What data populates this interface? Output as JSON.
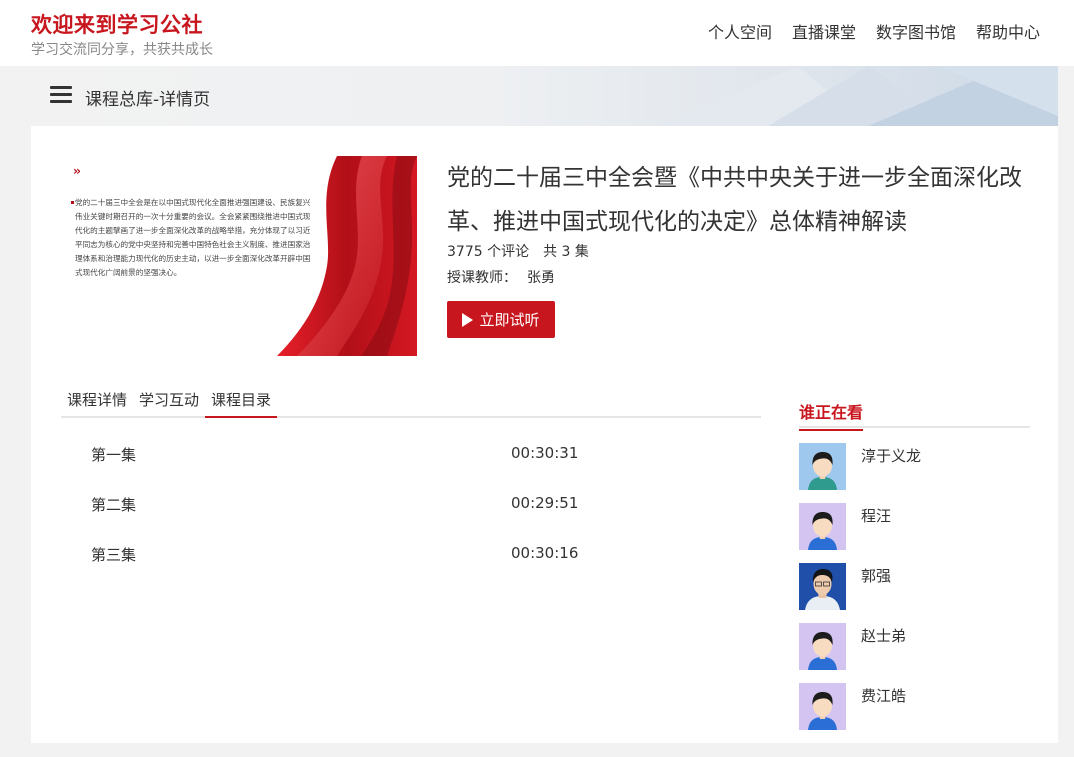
{
  "header": {
    "site_title": "欢迎来到学习公社",
    "site_subtitle": "学习交流同分享，共获共成长",
    "nav": [
      "个人空间",
      "直播课堂",
      "数字图书馆",
      "帮助中心"
    ]
  },
  "banner": {
    "menu_icon": "hamburger-icon",
    "breadcrumb": "课程总库-详情页"
  },
  "course": {
    "title": "党的二十届三中全会暨《中共中央关于进一步全面深化改革、推进中国式现代化的决定》总体精神解读",
    "comments": "3775 个评论",
    "episode_count": "共 3 集",
    "teacher_label": "授课教师：",
    "teacher_name": "张勇",
    "play_button": "立即试听",
    "cover_arrows": "››",
    "cover_text": "党的二十届三中全会是在以中国式现代化全面推进强国建设、民族复兴伟业关键时期召开的一次十分重要的会议。全会紧紧围绕推进中国式现代化的主题擘画了进一步全面深化改革的战略举措，充分体现了以习近平同志为核心的党中央坚持和完善中国特色社会主义制度、推进国家治理体系和治理能力现代化的历史主动，以进一步全面深化改革开辟中国式现代化广阔前景的坚强决心。"
  },
  "tabs": [
    {
      "label": "课程详情",
      "active": false
    },
    {
      "label": "学习互动",
      "active": false
    },
    {
      "label": "课程目录",
      "active": true
    }
  ],
  "episodes": [
    {
      "name": "第一集",
      "duration": "00:30:31"
    },
    {
      "name": "第二集",
      "duration": "00:29:51"
    },
    {
      "name": "第三集",
      "duration": "00:30:16"
    }
  ],
  "sidebar": {
    "title": "谁正在看",
    "viewers": [
      {
        "name": "淳于义龙",
        "avatar": "default-avatar-blue"
      },
      {
        "name": "程汪",
        "avatar": "default-avatar-purple"
      },
      {
        "name": "郭强",
        "avatar": "photo-avatar"
      },
      {
        "name": "赵士弟",
        "avatar": "default-avatar-purple"
      },
      {
        "name": "费江皓",
        "avatar": "default-avatar-purple"
      }
    ]
  },
  "colors": {
    "brand_red": "#c8161e",
    "text": "#333333",
    "muted": "#888888",
    "page_bg": "#f2f2f2"
  }
}
